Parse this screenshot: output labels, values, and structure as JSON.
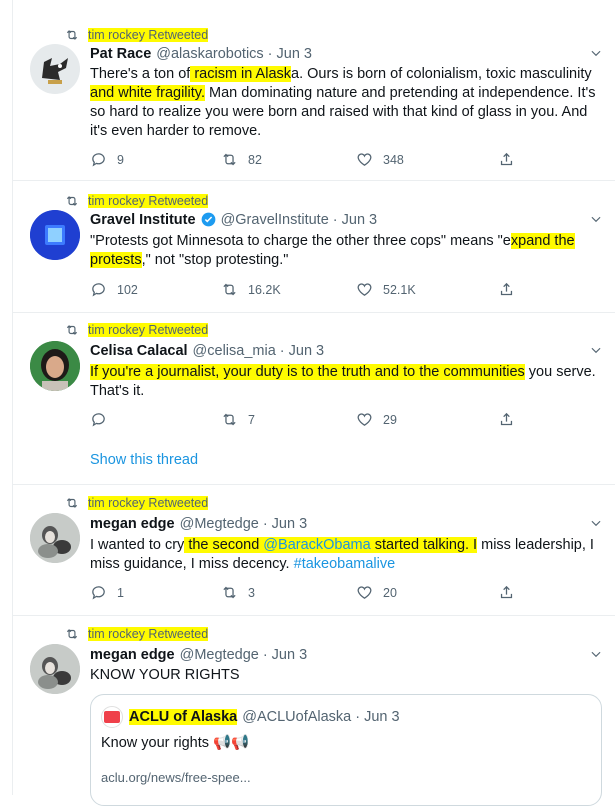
{
  "retweet_label": "tim rockey Retweeted",
  "tweets": [
    {
      "name": "Pat Race",
      "handle": "@alaskarobotics",
      "sep": "·",
      "time": "Jun 3",
      "text_parts": [
        "There's a ton of",
        " racism in Alask",
        "a. Ours is born of colonialism, toxic masculinity",
        " and white fragility.",
        " Man dominating nature and pretending at independence. It's so hard to realize you were born and raised with that kind of glass in you. And it's even harder to remove."
      ],
      "replies": "9",
      "retweets": "82",
      "likes": "348"
    },
    {
      "name": "Gravel Institute",
      "handle": "@GravelInstitute",
      "sep": "·",
      "time": "Jun 3",
      "text_parts": [
        "\"Protests got Minnesota to charge the other three cops\" means \"e",
        "xpand the protests",
        ",\" not \"stop protesting.\""
      ],
      "replies": "102",
      "retweets": "16.2K",
      "likes": "52.1K"
    },
    {
      "name": "Celisa Calacal",
      "handle": "@celisa_mia",
      "sep": "·",
      "time": "Jun 3",
      "text_parts": [
        "If you're a journalist, your duty is to the truth and to the communities",
        " you serve. That's it."
      ],
      "replies": "",
      "retweets": "7",
      "likes": "29",
      "show_thread": "Show this thread"
    },
    {
      "name": "megan edge",
      "handle": "@Megtedge",
      "sep": "·",
      "time": "Jun 3",
      "text_parts": [
        "I wanted to cry",
        " the second ",
        "@BarackObama",
        " started talking. I",
        " miss leadership, I miss guidance, I miss decency. ",
        "#takeobamalive"
      ],
      "replies": "1",
      "retweets": "3",
      "likes": "20"
    },
    {
      "name": "megan edge",
      "handle": "@Megtedge",
      "sep": "·",
      "time": "Jun 3",
      "text_parts": [
        "KNOW YOUR RIGHTS"
      ],
      "quote": {
        "avatar_text": "ACLU",
        "name": "ACLU of Alaska",
        "handle": "@ACLUofAlaska",
        "sep": "·",
        "time": "Jun 3",
        "text": "Know your rights 📢📢",
        "link": "aclu.org/news/free-spee..."
      }
    }
  ],
  "colors": {
    "highlight": "#fffb00",
    "link": "#1b95e0",
    "verified": "#1d9bf0",
    "secondary_text": "#536471"
  },
  "icons": [
    "retweet-icon",
    "reply-icon",
    "like-icon",
    "share-icon",
    "caret-down-icon",
    "verified-badge-icon"
  ]
}
